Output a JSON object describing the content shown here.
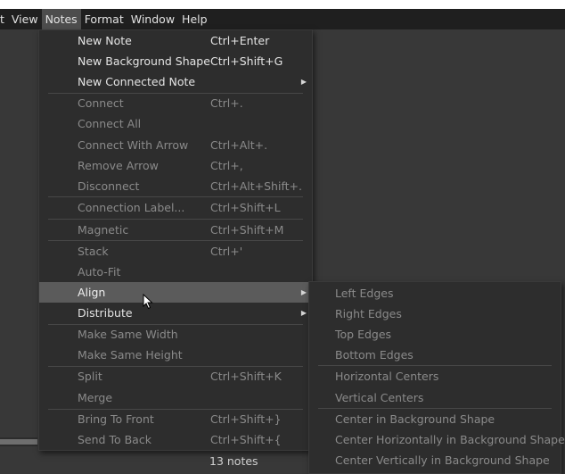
{
  "menubar": {
    "items": [
      {
        "label": "t",
        "active": false
      },
      {
        "label": "View",
        "active": false
      },
      {
        "label": "Notes",
        "active": true
      },
      {
        "label": "Format",
        "active": false
      },
      {
        "label": "Window",
        "active": false
      },
      {
        "label": "Help",
        "active": false
      }
    ]
  },
  "notes_menu": {
    "items": [
      {
        "label": "New Note",
        "shortcut": "Ctrl+Enter",
        "enabled": true
      },
      {
        "label": "New Background Shape",
        "shortcut": "Ctrl+Shift+G",
        "enabled": true
      },
      {
        "label": "New Connected Note",
        "shortcut": "",
        "enabled": true,
        "submenu": true
      },
      {
        "label": "Connect",
        "shortcut": "Ctrl+.",
        "enabled": false
      },
      {
        "label": "Connect All",
        "shortcut": "",
        "enabled": false
      },
      {
        "label": "Connect With Arrow",
        "shortcut": "Ctrl+Alt+.",
        "enabled": false
      },
      {
        "label": "Remove Arrow",
        "shortcut": "Ctrl+,",
        "enabled": false
      },
      {
        "label": "Disconnect",
        "shortcut": "Ctrl+Alt+Shift+.",
        "enabled": false
      },
      {
        "label": "Connection Label...",
        "shortcut": "Ctrl+Shift+L",
        "enabled": false
      },
      {
        "label": "Magnetic",
        "shortcut": "Ctrl+Shift+M",
        "enabled": false
      },
      {
        "label": "Stack",
        "shortcut": "Ctrl+'",
        "enabled": false
      },
      {
        "label": "Auto-Fit",
        "shortcut": "",
        "enabled": false
      },
      {
        "label": "Align",
        "shortcut": "",
        "enabled": true,
        "submenu": true,
        "highlighted": true
      },
      {
        "label": "Distribute",
        "shortcut": "",
        "enabled": true,
        "submenu": true
      },
      {
        "label": "Make Same Width",
        "shortcut": "",
        "enabled": false
      },
      {
        "label": "Make Same Height",
        "shortcut": "",
        "enabled": false
      },
      {
        "label": "Split",
        "shortcut": "Ctrl+Shift+K",
        "enabled": false
      },
      {
        "label": "Merge",
        "shortcut": "",
        "enabled": false
      },
      {
        "label": "Bring To Front",
        "shortcut": "Ctrl+Shift+}",
        "enabled": false
      },
      {
        "label": "Send To Back",
        "shortcut": "Ctrl+Shift+{",
        "enabled": false
      }
    ]
  },
  "align_submenu": {
    "items": [
      {
        "label": "Left Edges",
        "enabled": false
      },
      {
        "label": "Right Edges",
        "enabled": false
      },
      {
        "label": "Top Edges",
        "enabled": false
      },
      {
        "label": "Bottom Edges",
        "enabled": false
      },
      {
        "label": "Horizontal Centers",
        "enabled": false
      },
      {
        "label": "Vertical Centers",
        "enabled": false
      },
      {
        "label": "Center in Background Shape",
        "enabled": false
      },
      {
        "label": "Center Horizontally in Background Shape",
        "enabled": false
      },
      {
        "label": "Center Vertically in Background Shape",
        "enabled": false
      }
    ]
  },
  "status": {
    "note_count": "13 notes"
  },
  "icons": {
    "submenu_arrow": "chevron-right-icon",
    "cursor": "mouse-pointer-icon"
  }
}
